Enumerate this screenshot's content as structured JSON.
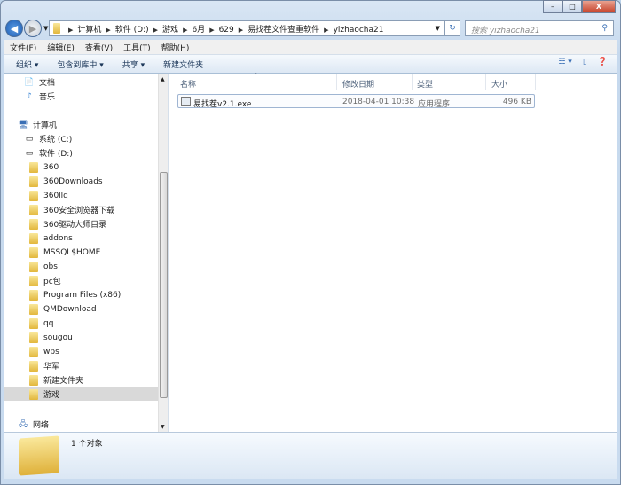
{
  "window": {
    "minimize": "–",
    "maximize": "□",
    "close": "X"
  },
  "address": {
    "crumbs": [
      "计算机",
      "软件 (D:)",
      "游戏",
      "6月",
      "629",
      "易找茬文件查重软件",
      "yizhaocha21"
    ]
  },
  "search": {
    "placeholder": "搜索 yizhaocha21"
  },
  "menu": [
    "文件(F)",
    "编辑(E)",
    "查看(V)",
    "工具(T)",
    "帮助(H)"
  ],
  "toolbar": {
    "organize": "组织 ▾",
    "include": "包含到库中 ▾",
    "share": "共享 ▾",
    "new_folder": "新建文件夹"
  },
  "sidebar": {
    "libraries": [
      "文档",
      "音乐"
    ],
    "computer": "计算机",
    "drives": [
      "系统 (C:)",
      "软件 (D:)"
    ],
    "folders": [
      "360",
      "360Downloads",
      "360llq",
      "360安全浏览器下载",
      "360驱动大师目录",
      "addons",
      "MSSQL$HOME",
      "obs",
      "pc包",
      "Program Files (x86)",
      "QMDownload",
      "qq",
      "sougou",
      "wps",
      "华军",
      "新建文件夹",
      "游戏"
    ],
    "selected": "游戏",
    "network": "网络"
  },
  "columns": [
    "名称",
    "修改日期",
    "类型",
    "大小"
  ],
  "files": [
    {
      "name": "易找茬v2.1.exe",
      "modified": "2018-04-01 10:38",
      "type": "应用程序",
      "size": "496 KB"
    }
  ],
  "status": {
    "count": "1 个对象"
  }
}
